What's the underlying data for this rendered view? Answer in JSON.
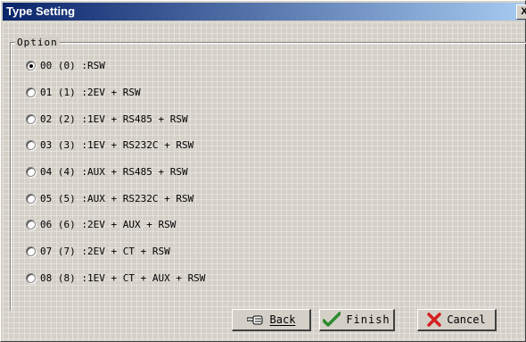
{
  "window": {
    "title": "Type Setting",
    "close_glyph": "X"
  },
  "group": {
    "label": "Option"
  },
  "options": [
    {
      "label": "00 (0) :RSW",
      "selected": true
    },
    {
      "label": "01 (1) :2EV + RSW",
      "selected": false
    },
    {
      "label": "02 (2) :1EV + RS485 + RSW",
      "selected": false
    },
    {
      "label": "03 (3) :1EV + RS232C + RSW",
      "selected": false
    },
    {
      "label": "04 (4) :AUX + RS485 + RSW",
      "selected": false
    },
    {
      "label": "05 (5) :AUX + RS232C + RSW",
      "selected": false
    },
    {
      "label": "06 (6) :2EV + AUX + RSW",
      "selected": false
    },
    {
      "label": "07 (7) :2EV + CT + RSW",
      "selected": false
    },
    {
      "label": "08 (8) :1EV + CT + AUX + RSW",
      "selected": false
    }
  ],
  "buttons": {
    "back": {
      "label": "Back",
      "icon": "hand-pointing-left-icon"
    },
    "finish": {
      "label": "Finish",
      "icon": "green-checkmark-icon"
    },
    "cancel": {
      "label": "Cancel",
      "icon": "red-x-icon"
    }
  },
  "colors": {
    "titlebar_start": "#0a246a",
    "titlebar_end": "#a6caf0",
    "face": "#d4d0c8",
    "check_green": "#2e8b2e",
    "cancel_red": "#d42020"
  }
}
